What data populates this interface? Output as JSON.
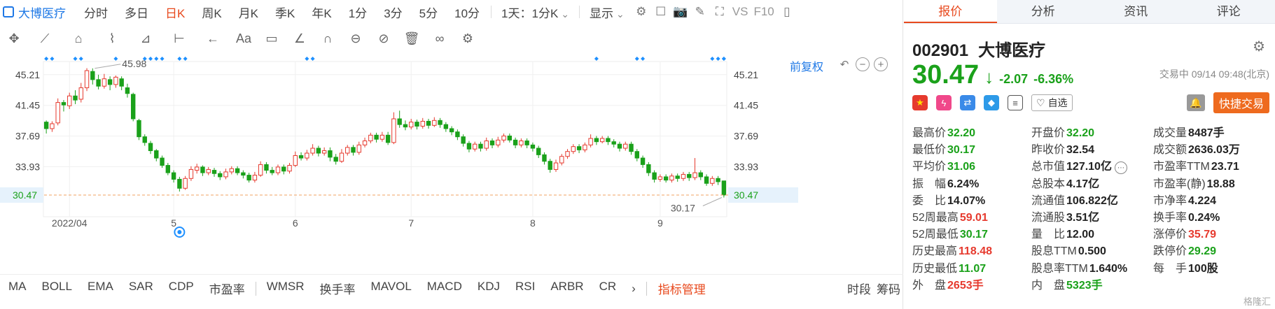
{
  "toolbar": {
    "stock_name": "大博医疗",
    "timeframes": [
      "分时",
      "多日",
      "日K",
      "周K",
      "月K",
      "季K",
      "年K",
      "1分",
      "3分",
      "5分",
      "10分"
    ],
    "active_timeframe": "日K",
    "interval_select": "1天：1分K",
    "display_select": "显示",
    "vs_label": "VS",
    "f10_label": "F10"
  },
  "chart": {
    "adjust_label": "前复权",
    "high_marker": "45.98",
    "low_marker": "30.17",
    "current_price_tag": "30.47",
    "y_ticks": [
      "45.21",
      "41.45",
      "37.69",
      "33.93",
      "30.47"
    ],
    "x_ticks": [
      "2022/04",
      "5",
      "6",
      "7",
      "8",
      "9"
    ],
    "colors": {
      "up": "#e63a2e",
      "down": "#1aa11a",
      "marker": "#1e90ff",
      "price_line": "#f0a060"
    }
  },
  "chart_data": {
    "type": "candlestick",
    "ylim": [
      28.5,
      47.5
    ],
    "y_ticks": [
      45.21,
      41.45,
      37.69,
      33.93,
      30.47
    ],
    "x_ticks": [
      "2022/04",
      "5",
      "6",
      "7",
      "8",
      "9"
    ],
    "current_price": 30.47,
    "annotations": [
      {
        "label": "45.98",
        "value": 45.98
      },
      {
        "label": "30.17",
        "value": 30.17
      }
    ],
    "candles": [
      [
        39.4,
        38.6,
        39.6,
        38.0
      ],
      [
        38.6,
        39.2,
        39.5,
        38.2
      ],
      [
        39.3,
        41.8,
        42.3,
        39.0
      ],
      [
        41.8,
        41.5,
        42.1,
        40.7
      ],
      [
        41.4,
        42.6,
        43.0,
        41.0
      ],
      [
        42.6,
        42.1,
        43.3,
        41.6
      ],
      [
        42.2,
        43.6,
        44.2,
        41.8
      ],
      [
        43.6,
        45.7,
        46.0,
        43.2
      ],
      [
        45.6,
        44.6,
        45.98,
        44.0
      ],
      [
        44.6,
        43.8,
        45.2,
        43.4
      ],
      [
        43.8,
        44.7,
        45.3,
        43.5
      ],
      [
        44.6,
        44.0,
        45.0,
        43.3
      ],
      [
        44.0,
        44.9,
        45.1,
        43.6
      ],
      [
        44.7,
        43.8,
        45.0,
        43.3
      ],
      [
        43.6,
        42.9,
        44.1,
        42.4
      ],
      [
        42.8,
        39.8,
        43.0,
        39.5
      ],
      [
        39.6,
        37.6,
        39.8,
        37.2
      ],
      [
        37.6,
        36.9,
        37.9,
        36.5
      ],
      [
        36.8,
        35.9,
        37.1,
        35.5
      ],
      [
        35.9,
        35.0,
        36.1,
        34.6
      ],
      [
        35.0,
        34.1,
        35.3,
        33.8
      ],
      [
        34.1,
        33.2,
        34.4,
        32.9
      ],
      [
        33.2,
        32.4,
        33.5,
        32.0
      ],
      [
        32.4,
        31.3,
        32.7,
        30.9
      ],
      [
        31.3,
        32.5,
        32.8,
        31.1
      ],
      [
        32.5,
        33.6,
        34.0,
        32.2
      ],
      [
        33.5,
        33.9,
        34.3,
        33.1
      ],
      [
        33.9,
        33.2,
        34.1,
        32.8
      ],
      [
        33.2,
        33.6,
        33.9,
        32.9
      ],
      [
        33.5,
        33.1,
        33.8,
        32.7
      ],
      [
        33.1,
        32.7,
        33.4,
        32.3
      ],
      [
        32.7,
        33.3,
        33.7,
        32.4
      ],
      [
        33.3,
        33.7,
        34.0,
        33.0
      ],
      [
        33.7,
        33.2,
        34.0,
        32.9
      ],
      [
        33.2,
        32.9,
        33.5,
        32.5
      ],
      [
        32.9,
        32.3,
        33.2,
        32.0
      ],
      [
        32.3,
        32.9,
        33.3,
        32.0
      ],
      [
        32.9,
        34.2,
        34.6,
        32.7
      ],
      [
        34.2,
        33.5,
        34.5,
        33.1
      ],
      [
        33.5,
        33.2,
        33.9,
        32.9
      ],
      [
        33.2,
        33.9,
        34.2,
        32.9
      ],
      [
        33.9,
        33.4,
        34.2,
        33.0
      ],
      [
        33.4,
        34.1,
        34.4,
        33.1
      ],
      [
        34.1,
        35.3,
        35.8,
        33.9
      ],
      [
        35.3,
        35.0,
        35.7,
        34.7
      ],
      [
        35.0,
        35.6,
        36.0,
        34.7
      ],
      [
        35.6,
        36.2,
        36.7,
        35.3
      ],
      [
        36.2,
        35.6,
        36.5,
        35.2
      ],
      [
        35.6,
        35.9,
        36.3,
        35.3
      ],
      [
        35.9,
        35.1,
        36.3,
        34.6
      ],
      [
        35.1,
        34.6,
        35.5,
        34.2
      ],
      [
        34.6,
        35.6,
        36.1,
        34.4
      ],
      [
        35.6,
        36.3,
        36.6,
        35.3
      ],
      [
        36.3,
        35.7,
        36.6,
        35.3
      ],
      [
        35.7,
        36.6,
        37.0,
        35.4
      ],
      [
        36.6,
        37.1,
        37.5,
        36.3
      ],
      [
        37.1,
        37.8,
        38.1,
        36.8
      ],
      [
        37.8,
        37.3,
        38.1,
        36.9
      ],
      [
        37.3,
        37.8,
        38.2,
        37.0
      ],
      [
        37.8,
        36.9,
        38.2,
        36.6
      ],
      [
        36.9,
        39.8,
        40.6,
        36.7
      ],
      [
        39.8,
        39.1,
        40.8,
        38.7
      ],
      [
        39.1,
        38.8,
        39.6,
        38.4
      ],
      [
        38.8,
        39.4,
        39.8,
        38.5
      ],
      [
        39.4,
        38.9,
        39.7,
        38.5
      ],
      [
        38.9,
        39.5,
        39.9,
        38.6
      ],
      [
        39.5,
        39.0,
        39.8,
        38.6
      ],
      [
        39.0,
        39.6,
        40.0,
        38.8
      ],
      [
        39.6,
        39.1,
        39.9,
        38.7
      ],
      [
        39.1,
        38.6,
        39.4,
        38.2
      ],
      [
        38.6,
        38.2,
        38.9,
        37.8
      ],
      [
        38.2,
        37.6,
        38.5,
        37.2
      ],
      [
        37.6,
        36.8,
        37.9,
        36.4
      ],
      [
        36.8,
        36.1,
        37.1,
        35.7
      ],
      [
        36.1,
        36.7,
        37.0,
        35.8
      ],
      [
        36.7,
        36.2,
        37.0,
        35.8
      ],
      [
        36.2,
        37.1,
        37.5,
        35.9
      ],
      [
        37.1,
        36.6,
        37.4,
        36.2
      ],
      [
        36.6,
        37.2,
        37.6,
        36.3
      ],
      [
        37.2,
        37.7,
        38.0,
        36.9
      ],
      [
        37.7,
        37.2,
        38.0,
        36.9
      ],
      [
        37.2,
        36.6,
        37.5,
        36.2
      ],
      [
        36.6,
        37.1,
        37.4,
        36.3
      ],
      [
        37.1,
        36.6,
        37.4,
        36.2
      ],
      [
        36.6,
        36.2,
        36.9,
        35.8
      ],
      [
        36.2,
        35.4,
        36.5,
        35.0
      ],
      [
        35.4,
        34.6,
        35.7,
        34.2
      ],
      [
        34.6,
        33.6,
        34.9,
        33.2
      ],
      [
        33.6,
        34.4,
        34.8,
        33.3
      ],
      [
        34.4,
        35.2,
        35.5,
        34.1
      ],
      [
        35.2,
        35.8,
        36.1,
        34.9
      ],
      [
        35.8,
        36.4,
        36.7,
        35.5
      ],
      [
        36.4,
        36.0,
        36.7,
        35.6
      ],
      [
        36.0,
        36.6,
        36.9,
        35.7
      ],
      [
        36.6,
        37.4,
        37.9,
        36.3
      ],
      [
        37.4,
        37.0,
        37.7,
        36.6
      ],
      [
        37.0,
        37.4,
        37.7,
        36.8
      ],
      [
        37.4,
        37.0,
        37.7,
        36.6
      ],
      [
        37.0,
        36.7,
        37.3,
        36.3
      ],
      [
        36.7,
        36.2,
        37.0,
        35.8
      ],
      [
        36.2,
        36.7,
        37.0,
        35.9
      ],
      [
        36.7,
        35.8,
        37.0,
        35.4
      ],
      [
        35.8,
        35.0,
        36.1,
        34.6
      ],
      [
        35.0,
        34.2,
        35.3,
        33.8
      ],
      [
        34.2,
        33.2,
        34.5,
        32.8
      ],
      [
        33.2,
        32.4,
        33.5,
        32.0
      ],
      [
        32.4,
        32.7,
        33.0,
        32.1
      ],
      [
        32.7,
        32.3,
        33.0,
        32.0
      ],
      [
        32.3,
        32.8,
        33.1,
        32.0
      ],
      [
        32.8,
        32.5,
        33.1,
        32.1
      ],
      [
        32.5,
        33.0,
        33.3,
        32.2
      ],
      [
        33.0,
        32.6,
        33.3,
        32.2
      ],
      [
        32.6,
        33.2,
        35.0,
        32.3
      ],
      [
        33.2,
        32.7,
        33.5,
        32.3
      ],
      [
        32.7,
        31.9,
        33.0,
        31.6
      ],
      [
        31.9,
        32.5,
        32.8,
        31.6
      ],
      [
        32.5,
        32.1,
        32.8,
        31.7
      ],
      [
        32.2,
        30.47,
        32.2,
        30.17
      ]
    ]
  },
  "quote": {
    "tabs": [
      "报价",
      "分析",
      "资讯",
      "评论"
    ],
    "active_tab": "报价",
    "code": "002901",
    "name": "大博医疗",
    "price": "30.47",
    "arrow": "↓",
    "change": "-2.07",
    "change_pct": "-6.36%",
    "status": "交易中 09/14 09:48(北京)",
    "fav_label": "自选",
    "quick_trade": "快捷交易",
    "rows": [
      [
        {
          "label": "最高价",
          "value": "32.20",
          "color": "green"
        },
        {
          "label": "开盘价",
          "value": "32.20",
          "color": "green"
        },
        {
          "label": "成交量",
          "value": "8487手",
          "color": "dark"
        }
      ],
      [
        {
          "label": "最低价",
          "value": "30.17",
          "color": "green"
        },
        {
          "label": "昨收价",
          "value": "32.54",
          "color": "dark"
        },
        {
          "label": "成交额",
          "value": "2636.03万",
          "color": "dark"
        }
      ],
      [
        {
          "label": "平均价",
          "value": "31.06",
          "color": "green"
        },
        {
          "label": "总市值",
          "value": "127.10亿",
          "color": "dark"
        },
        {
          "label": "市盈率TTM",
          "value": "23.71",
          "color": "dark"
        }
      ],
      [
        {
          "label": "振　幅",
          "value": "6.24%",
          "color": "dark"
        },
        {
          "label": "总股本",
          "value": "4.17亿",
          "color": "dark"
        },
        {
          "label": "市盈率(静)",
          "value": "18.88",
          "color": "dark"
        }
      ],
      [
        {
          "label": "委　比",
          "value": "14.07%",
          "color": "dark"
        },
        {
          "label": "流通值",
          "value": "106.822亿",
          "color": "dark"
        },
        {
          "label": "市净率",
          "value": "4.224",
          "color": "dark"
        }
      ],
      [
        {
          "label": "52周最高",
          "value": "59.01",
          "color": "red"
        },
        {
          "label": "流通股",
          "value": "3.51亿",
          "color": "dark"
        },
        {
          "label": "换手率",
          "value": "0.24%",
          "color": "dark"
        }
      ],
      [
        {
          "label": "52周最低",
          "value": "30.17",
          "color": "green"
        },
        {
          "label": "量　比",
          "value": "12.00",
          "color": "dark"
        },
        {
          "label": "涨停价",
          "value": "35.79",
          "color": "red"
        }
      ],
      [
        {
          "label": "历史最高",
          "value": "118.48",
          "color": "red"
        },
        {
          "label": "股息TTM",
          "value": "0.500",
          "color": "dark"
        },
        {
          "label": "跌停价",
          "value": "29.29",
          "color": "green"
        }
      ],
      [
        {
          "label": "历史最低",
          "value": "11.07",
          "color": "green"
        },
        {
          "label": "股息率TTM",
          "value": "1.640%",
          "color": "dark"
        },
        {
          "label": "每　手",
          "value": "100股",
          "color": "dark"
        }
      ],
      [
        {
          "label": "外　盘",
          "value": "2653手",
          "color": "red"
        },
        {
          "label": "内　盘",
          "value": "5323手",
          "color": "green"
        },
        {
          "label": "",
          "value": "",
          "color": "dark"
        }
      ]
    ]
  },
  "indicators": {
    "group1": [
      "MA",
      "BOLL",
      "EMA",
      "SAR",
      "CDP",
      "市盈率"
    ],
    "group2": [
      "WMSR",
      "换手率",
      "MAVOL",
      "MACD",
      "KDJ",
      "RSI",
      "ARBR",
      "CR"
    ],
    "manage": "指标管理",
    "right": [
      "时段",
      "筹码"
    ]
  },
  "watermark": "格隆汇"
}
